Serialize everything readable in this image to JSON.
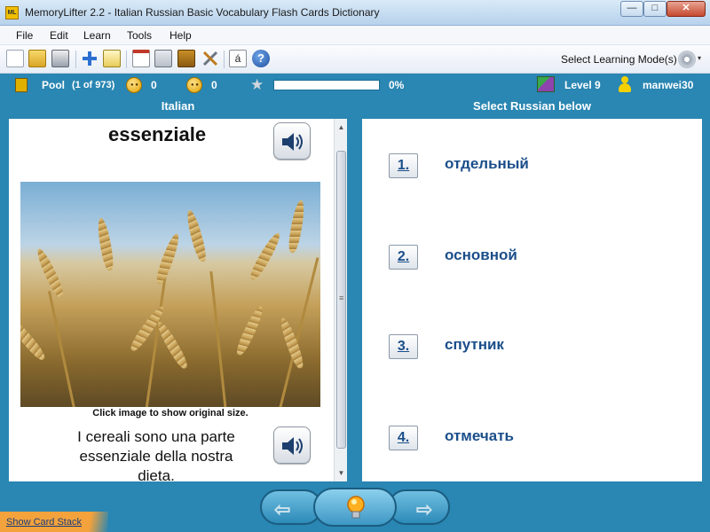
{
  "window": {
    "title": "MemoryLifter 2.2 - Italian Russian Basic Vocabulary Flash Cards Dictionary",
    "app_icon_text": "ML",
    "minimize": "—",
    "maximize": "□",
    "close": "✕"
  },
  "menu": [
    "File",
    "Edit",
    "Learn",
    "Tools",
    "Help"
  ],
  "toolbar": {
    "icons": [
      "new-icon",
      "open-icon",
      "print-icon",
      "add-card-icon",
      "edit-icon",
      "slideshow-icon",
      "statistics-icon",
      "dictionary-icon",
      "settings-tools-icon",
      "character-map-icon",
      "help-icon"
    ],
    "char_map_glyph": "á",
    "help_glyph": "?",
    "mode_label": "Select Learning Mode(s)",
    "mode_caret": "▾"
  },
  "status": {
    "pool_label": "Pool",
    "pool_count": "(1 of 973)",
    "correct_count": "0",
    "wrong_count": "0",
    "progress_label": "0%",
    "progress_fraction": 0,
    "level": "Level 9",
    "user": "manwei30"
  },
  "columns": {
    "left_header": "Italian",
    "right_header": "Select Russian below"
  },
  "card": {
    "word": "essenziale",
    "caption": "Click image to show original size.",
    "sentence": "I cereali sono una parte essenziale della nostra dieta."
  },
  "scrollbar": {
    "up": "▲",
    "down": "▼",
    "grip": "≡"
  },
  "choices": [
    {
      "num": "1.",
      "text": "отдельный"
    },
    {
      "num": "2.",
      "text": "основной"
    },
    {
      "num": "3.",
      "text": "спутник"
    },
    {
      "num": "4.",
      "text": "отмечать"
    }
  ],
  "nav": {
    "prev_glyph": "⇦",
    "next_glyph": "⇨"
  },
  "footer": {
    "show_card_stack": "Show Card Stack"
  }
}
